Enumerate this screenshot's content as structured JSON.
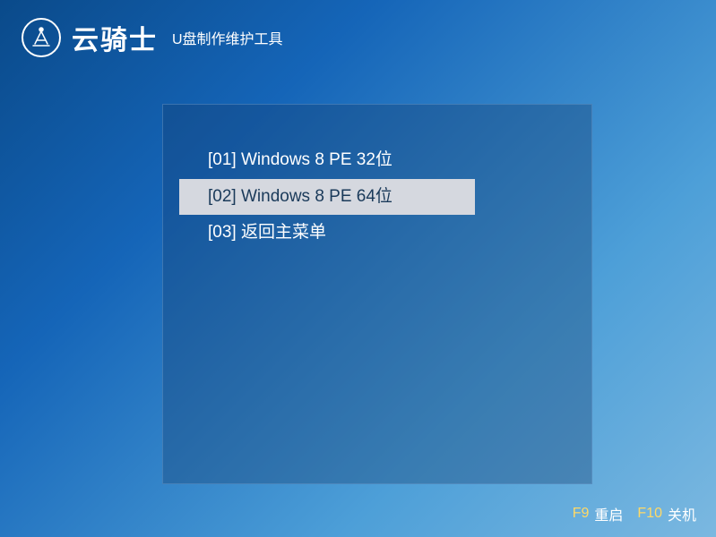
{
  "header": {
    "brand": "云骑士",
    "subtitle": "U盘制作维护工具"
  },
  "menu": {
    "items": [
      {
        "label": "[01] Windows 8 PE 32位",
        "selected": false
      },
      {
        "label": "[02] Windows 8 PE 64位",
        "selected": true
      },
      {
        "label": "[03] 返回主菜单",
        "selected": false
      }
    ]
  },
  "footer": {
    "items": [
      {
        "key": "F9",
        "label": "重启"
      },
      {
        "key": "F10",
        "label": "关机"
      }
    ]
  }
}
